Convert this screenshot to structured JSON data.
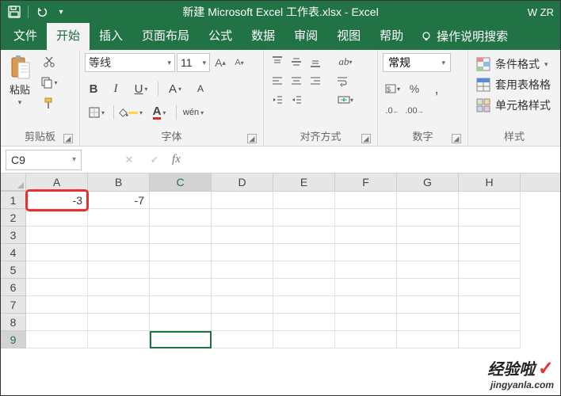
{
  "titlebar": {
    "title": "新建 Microsoft Excel 工作表.xlsx - Excel",
    "user_badge": "W ZR"
  },
  "tabs": {
    "items": [
      "文件",
      "开始",
      "插入",
      "页面布局",
      "公式",
      "数据",
      "审阅",
      "视图",
      "帮助"
    ],
    "active_index": 1,
    "tell_me": "操作说明搜索"
  },
  "ribbon": {
    "clipboard": {
      "label": "剪贴板",
      "paste": "粘贴"
    },
    "font": {
      "label": "字体",
      "name": "等线",
      "size": "11",
      "wen": "wén"
    },
    "alignment": {
      "label": "对齐方式"
    },
    "number": {
      "label": "数字",
      "format": "常规"
    },
    "styles": {
      "label": "样式",
      "conditional": "条件格式",
      "table": "套用表格格",
      "cell": "单元格样式"
    }
  },
  "formula_bar": {
    "name_box": "C9",
    "fx": "fx",
    "value": ""
  },
  "grid": {
    "columns": [
      "A",
      "B",
      "C",
      "D",
      "E",
      "F",
      "G",
      "H"
    ],
    "rows": [
      "1",
      "2",
      "3",
      "4",
      "5",
      "6",
      "7",
      "8",
      "9"
    ],
    "active": {
      "row": 9,
      "col": "C"
    },
    "cells": {
      "A1": "-3",
      "B1": "-7"
    }
  },
  "watermark": {
    "line1": "经验啦",
    "line2": "jingyanla.com"
  }
}
